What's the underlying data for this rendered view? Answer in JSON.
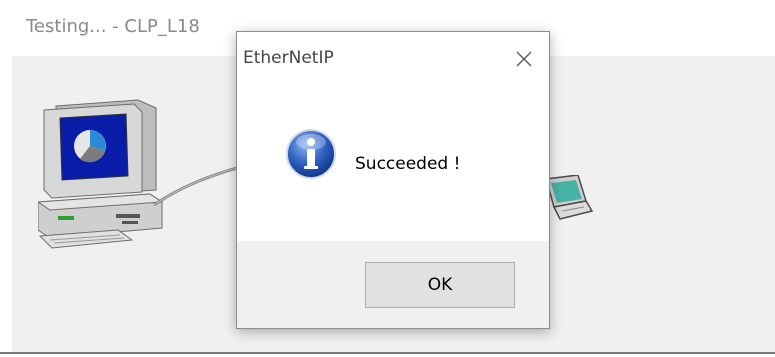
{
  "background_window": {
    "title": "Testing... - CLP_L18"
  },
  "dialog": {
    "title": "EtherNetIP",
    "message": "Succeeded !",
    "ok_label": "OK",
    "close_icon": "close-icon",
    "info_icon": "info-icon"
  },
  "colors": {
    "info_blue": "#2b5fbf",
    "dialog_footer": "#f0f0f0",
    "button_face": "#e1e1e1"
  }
}
